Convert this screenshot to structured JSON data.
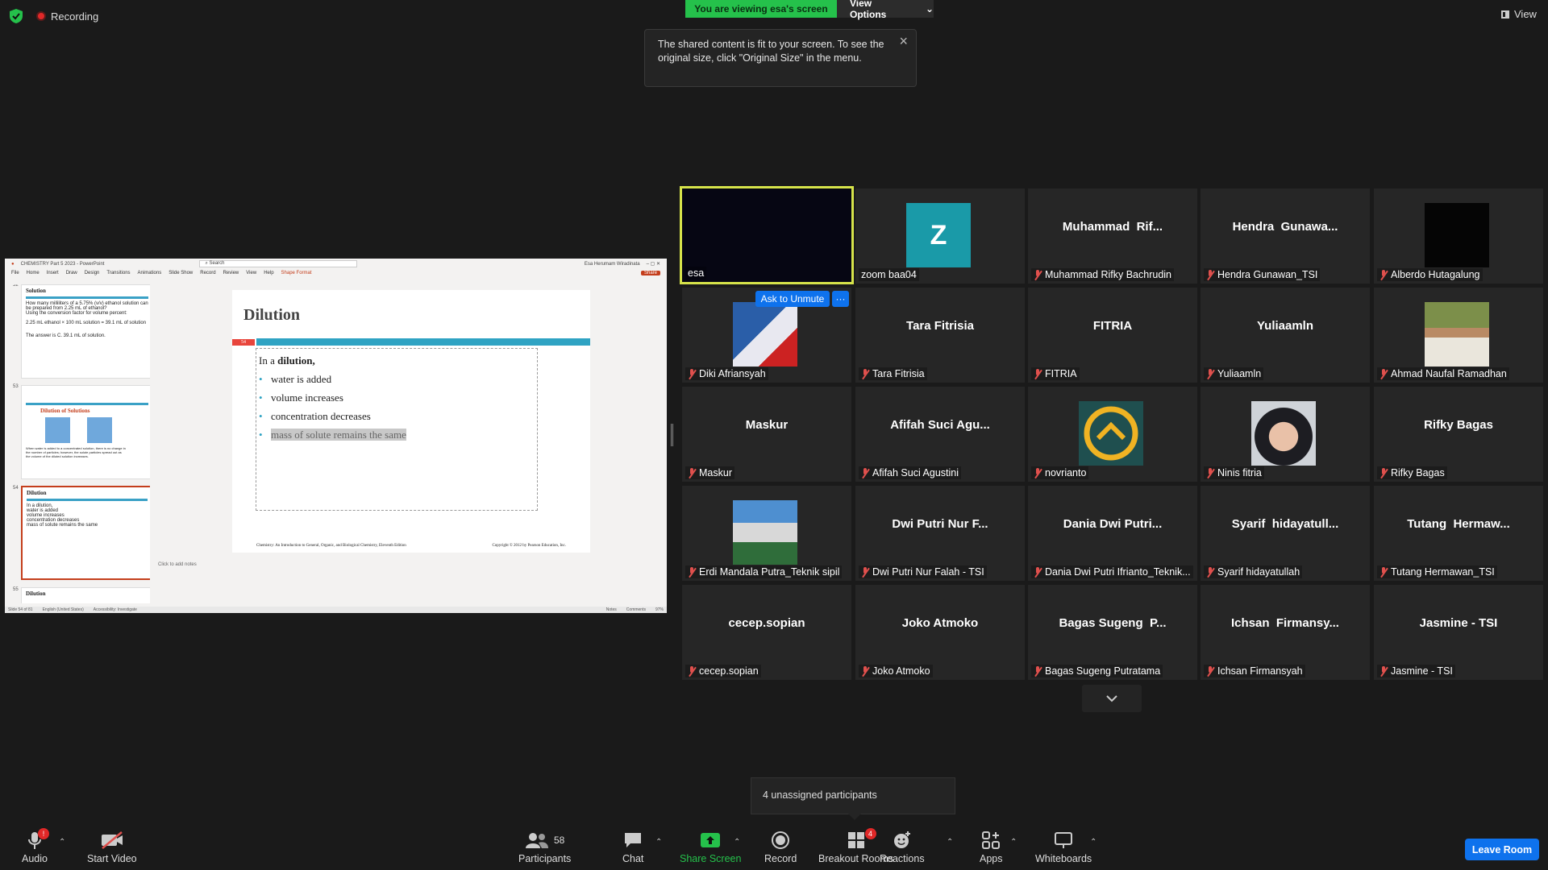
{
  "top": {
    "recording": "Recording",
    "viewing": "You are viewing esa's screen",
    "view_options": "View Options",
    "tip": "The shared content is fit to your screen. To see the original size, click \"Original Size\" in the menu.",
    "view": "View"
  },
  "ppt": {
    "title": "CHEMISTRY Part 5 2023  -  PowerPoint",
    "search": "Search",
    "user": "Esa Herumam Wiradinata",
    "ribbon": [
      "File",
      "Home",
      "Insert",
      "Draw",
      "Design",
      "Transitions",
      "Animations",
      "Slide Show",
      "Record",
      "Review",
      "View",
      "Help",
      "Shape Format"
    ],
    "share": "Share",
    "thumbs": [
      {
        "num": "52",
        "title": "Solution",
        "lines": [
          "How many milliliters of a 5.75% (v/v) ethanol solution can",
          "be prepared from 2.25 mL of ethanol?",
          "Using the conversion factor for volume percent:",
          "2.25 mL ethanol × 100 mL solution = 39.1 mL of solution",
          "The answer is C. 39.1 mL of solution."
        ]
      },
      {
        "num": "53",
        "title": "Dilution of Solutions",
        "lines": [
          "When water is added to a concentrated solution, there is no change in",
          "the number of particles; however, the solute particles spread out as",
          "the volume of the diluted solution increases."
        ]
      },
      {
        "num": "54",
        "title": "Dilution",
        "lines": [
          "In a dilution,",
          "water is added",
          "volume increases",
          "concentration decreases",
          "mass of solute remains the same"
        ]
      },
      {
        "num": "55",
        "title": "Dilution",
        "lines": []
      }
    ],
    "slide": {
      "title": "Dilution",
      "number": "54",
      "intro": "In a ",
      "intro_bold": "dilution,",
      "bullets": [
        "water is added",
        "volume increases",
        "concentration decreases"
      ],
      "highlight": "mass of solute remains the same",
      "footer_left": "Chemistry: An Introduction to General, Organic, and Biological Chemistry, Eleventh Edition",
      "footer_right": "Copyright © 2012 by Pearson Education, Inc."
    },
    "notes": "Click to add notes",
    "status": [
      "Slide 54 of 81",
      "English (United States)",
      "Accessibility: Investigate",
      "Notes",
      "Comments",
      "97%"
    ]
  },
  "gallery": [
    {
      "name": "",
      "label": "esa",
      "muted": false,
      "active": true
    },
    {
      "name": "",
      "label": "zoom baa04",
      "muted": false,
      "avatar": "Z"
    },
    {
      "name": "Muhammad  Rif...",
      "label": "Muhammad Rifky Bachrudin",
      "muted": true
    },
    {
      "name": "Hendra  Gunawa...",
      "label": "Hendra Gunawan_TSI",
      "muted": true
    },
    {
      "name": "",
      "label": "Alberdo Hutagalung",
      "muted": true,
      "avatar": "dark"
    },
    {
      "name": "",
      "label": "Diki Afriansyah",
      "muted": true,
      "avatar": "photo1"
    },
    {
      "name": "Tara Fitrisia",
      "label": "Tara Fitrisia",
      "muted": true
    },
    {
      "name": "FITRIA",
      "label": "FITRIA",
      "muted": true
    },
    {
      "name": "Yuliaamln",
      "label": "Yuliaamln",
      "muted": true
    },
    {
      "name": "",
      "label": "Ahmad Naufal Ramadhan",
      "muted": true,
      "avatar": "photo2"
    },
    {
      "name": "Maskur",
      "label": "Maskur",
      "muted": true
    },
    {
      "name": "Afifah Suci Agu...",
      "label": "Afifah Suci Agustini",
      "muted": true
    },
    {
      "name": "",
      "label": "novrianto",
      "muted": true,
      "avatar": "logo"
    },
    {
      "name": "",
      "label": "Ninis fitria",
      "muted": true,
      "avatar": "photo3"
    },
    {
      "name": "Rifky Bagas",
      "label": "Rifky Bagas",
      "muted": true
    },
    {
      "name": "",
      "label": "Erdi Mandala Putra_Teknik sipil",
      "muted": true,
      "avatar": "photo4"
    },
    {
      "name": "Dwi Putri Nur F...",
      "label": "Dwi Putri Nur Falah - TSI",
      "muted": true
    },
    {
      "name": "Dania Dwi Putri...",
      "label": "Dania Dwi Putri Ifrianto_Teknik...",
      "muted": true
    },
    {
      "name": "Syarif  hidayatull...",
      "label": "Syarif hidayatullah",
      "muted": true
    },
    {
      "name": "Tutang  Hermaw...",
      "label": "Tutang Hermawan_TSI",
      "muted": true
    },
    {
      "name": "cecep.sopian",
      "label": "cecep.sopian",
      "muted": true
    },
    {
      "name": "Joko Atmoko",
      "label": "Joko Atmoko",
      "muted": true
    },
    {
      "name": "Bagas Sugeng  P...",
      "label": "Bagas Sugeng Putratama",
      "muted": true
    },
    {
      "name": "Ichsan  Firmansy...",
      "label": "Ichsan Firmansyah",
      "muted": true
    },
    {
      "name": "Jasmine - TSI",
      "label": "Jasmine - TSI",
      "muted": true
    }
  ],
  "ask_unmute": "Ask to Unmute",
  "more": "···",
  "popup": "4 unassigned participants",
  "toolbar": {
    "audio": "Audio",
    "audio_badge": "!",
    "video": "Start Video",
    "participants": "Participants",
    "participants_count": "58",
    "chat": "Chat",
    "share": "Share Screen",
    "record": "Record",
    "breakout": "Breakout Rooms",
    "breakout_badge": "4",
    "reactions": "Reactions",
    "apps": "Apps",
    "whiteboards": "Whiteboards",
    "leave": "Leave Room"
  },
  "colors": {
    "accent": "#0e72ed",
    "green": "#25c14b",
    "muted": "#e0504d",
    "active_border": "#d6e34a",
    "slide_band": "#2fa3c3"
  }
}
